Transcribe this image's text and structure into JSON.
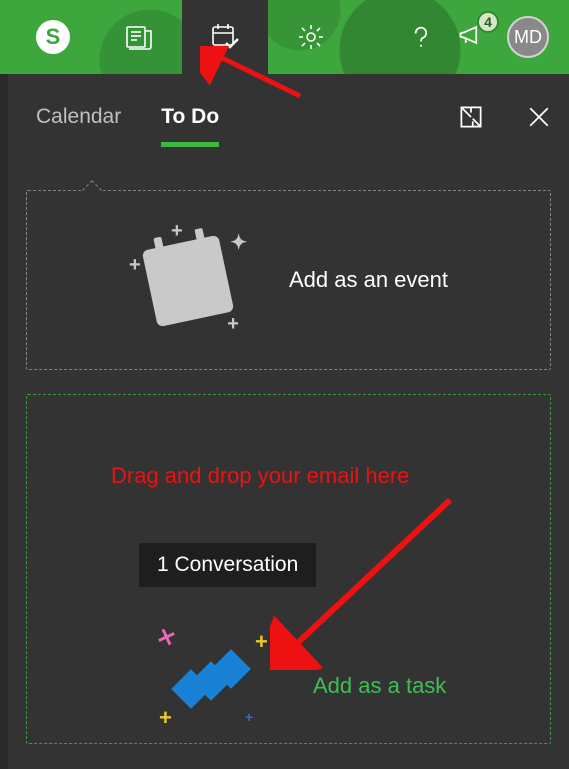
{
  "topbar": {
    "notif_count": "4",
    "avatar_initials": "MD"
  },
  "panel": {
    "tabs": {
      "calendar": "Calendar",
      "todo": "To Do"
    },
    "event_label": "Add as an event",
    "task_label": "Add as a task",
    "chip_label": "1 Conversation"
  },
  "annotations": {
    "drag_here": "Drag and drop your email here"
  }
}
